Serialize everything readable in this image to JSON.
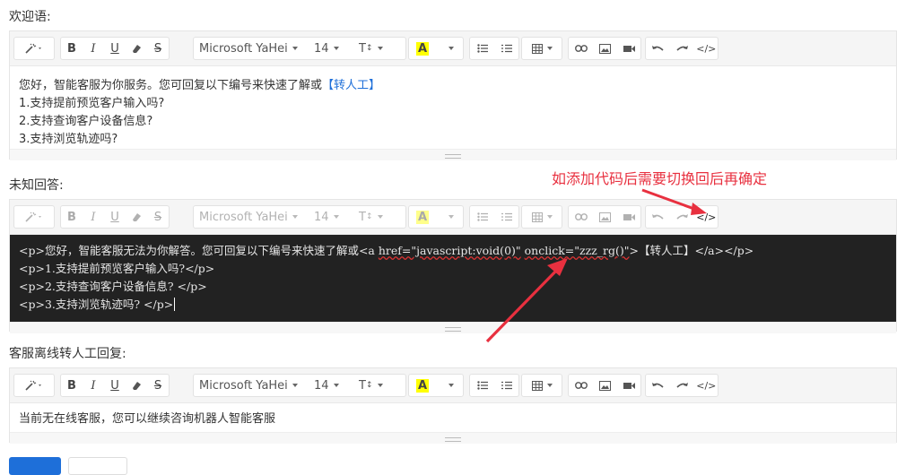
{
  "sections": [
    {
      "label": "欢迎语:"
    },
    {
      "label": "未知回答:"
    },
    {
      "label": "客服离线转人工回复:"
    }
  ],
  "toolbar": {
    "font_family": "Microsoft YaHei",
    "font_size": "14",
    "text_case": "T",
    "highlight": "A"
  },
  "welcome": {
    "line1_prefix": "您好，智能客服为你服务。您可回复以下编号来快速了解或",
    "line1_link": "【转人工】",
    "line2": "1.支持提前预览客户输入吗?",
    "line3": "2.支持查询客户设备信息?",
    "line4": "3.支持浏览轨迹吗?"
  },
  "unknown": {
    "code1_a": "<p>您好，智能客服无法为你解答。您可回复以下编号来快速了解或<a ",
    "code1_href": "href=\"javascript:void(0)\"",
    "code1_sp": " ",
    "code1_onclick": "onclick=\"zzz_rg()\"",
    "code1_b": ">【转人工】</a></p>",
    "code2": "<p>1.支持提前预览客户输入吗?</p>",
    "code3": "<p>2.支持查询客户设备信息? </p>",
    "code4": "<p>3.支持浏览轨迹吗? </p>"
  },
  "offline": {
    "text": "当前无在线客服，您可以继续咨询机器人智能客服"
  },
  "annotation": "如添加代码后需要切换回后再确定"
}
